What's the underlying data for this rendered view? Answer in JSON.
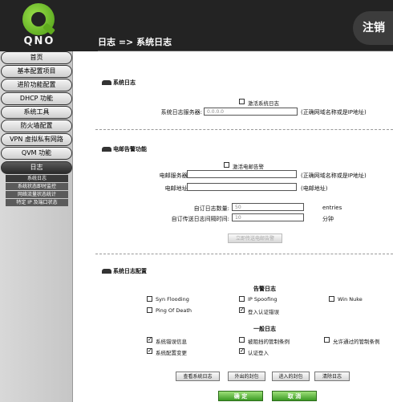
{
  "header": {
    "brand": "QNO",
    "page_title": "日志 => 系统日志",
    "logout_label": "注销"
  },
  "sidebar": {
    "items": [
      {
        "label": "首页"
      },
      {
        "label": "基本配置项目"
      },
      {
        "label": "进阶功能配置"
      },
      {
        "label": "DHCP 功能"
      },
      {
        "label": "系统工具"
      },
      {
        "label": "防火墙配置"
      },
      {
        "label": "VPN 虚拟私有网路"
      },
      {
        "label": "QVM 功能"
      },
      {
        "label": "日志"
      }
    ],
    "subitems": [
      {
        "label": "系统日志"
      },
      {
        "label": "系统状态即时监控"
      },
      {
        "label": "网络流量状态统计"
      },
      {
        "label": "特定 IP 及端口状态"
      }
    ]
  },
  "syslog": {
    "title": "系统日志",
    "enable_label": "激活系统日志",
    "server_label": "系统日志服务器:",
    "server_value": "0.0.0.0",
    "server_hint": "(正确网域名称或是IP地址)"
  },
  "email": {
    "title": "电邮告警功能",
    "enable_label": "激活电邮告警",
    "server_label": "电邮服务器:",
    "server_hint": "(正确网域名称或是IP地址)",
    "address_label": "电邮地址:",
    "address_hint": "(电邮地址)",
    "count_label": "自订日志数量:",
    "count_value": "50",
    "count_unit": "entries",
    "interval_label": "自订传送日志间隔时间:",
    "interval_value": "10",
    "interval_unit": "分钟",
    "send_now_label": "立即传送电邮告警"
  },
  "logconfig": {
    "title": "系统日志配置",
    "alert_heading": "告警日志",
    "alert_items": [
      {
        "label": "Syn Flooding",
        "checked": false
      },
      {
        "label": "IP Spoofing",
        "checked": false
      },
      {
        "label": "Win Nuke",
        "checked": false
      },
      {
        "label": "Ping Of Death",
        "checked": false
      },
      {
        "label": "登入认证错误",
        "checked": true
      }
    ],
    "general_heading": "一般日志",
    "general_items": [
      {
        "label": "系统错误信息",
        "checked": true
      },
      {
        "label": "被阻挡的管制条例",
        "checked": false
      },
      {
        "label": "允许通过的管制条例",
        "checked": false
      },
      {
        "label": "系统配置变更",
        "checked": true
      },
      {
        "label": "认证登入",
        "checked": true
      }
    ],
    "buttons": [
      "查看系统日志",
      "外出的封包",
      "进入的封包",
      "清除日志"
    ]
  },
  "footer": {
    "ok_label": "确 定",
    "cancel_label": "取 消"
  }
}
